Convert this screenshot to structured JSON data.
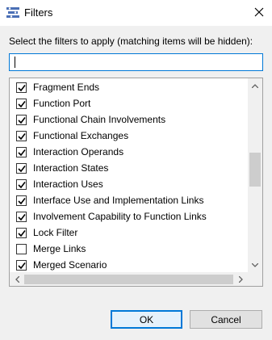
{
  "window": {
    "title": "Filters",
    "close_label": "✕"
  },
  "instruction": "Select the filters to apply (matching items will be hidden):",
  "filter_input": {
    "value": ""
  },
  "items": [
    {
      "label": "Fragment Ends",
      "checked": true
    },
    {
      "label": "Function Port",
      "checked": true
    },
    {
      "label": "Functional Chain Involvements",
      "checked": true
    },
    {
      "label": "Functional Exchanges",
      "checked": true
    },
    {
      "label": "Interaction Operands",
      "checked": true
    },
    {
      "label": "Interaction States",
      "checked": true
    },
    {
      "label": "Interaction Uses",
      "checked": true
    },
    {
      "label": "Interface Use and Implementation Links",
      "checked": true
    },
    {
      "label": "Involvement Capability to Function Links",
      "checked": true
    },
    {
      "label": "Lock Filter",
      "checked": true
    },
    {
      "label": "Merge Links",
      "checked": false
    },
    {
      "label": "Merged Scenario",
      "checked": true
    }
  ],
  "buttons": {
    "ok": "OK",
    "cancel": "Cancel"
  },
  "colors": {
    "accent": "#0078d7",
    "dialog_bg": "#f0f0f0",
    "scrollbar_thumb": "#cdcdcd"
  }
}
